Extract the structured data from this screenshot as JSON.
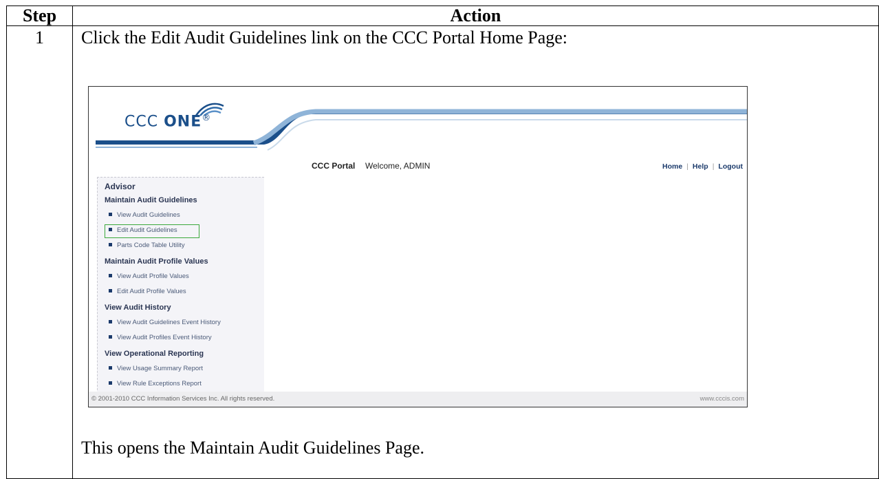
{
  "table": {
    "header_step": "Step",
    "header_action": "Action",
    "rows": [
      {
        "step": "1",
        "instruction": "Click the Edit Audit Guidelines link on the CCC Portal Home Page:",
        "result": "This opens the Maintain Audit Guidelines Page."
      }
    ]
  },
  "screenshot": {
    "logo": {
      "word1": "CCC ",
      "word2": "ONE",
      "mark": "®"
    },
    "portal_name": "CCC Portal",
    "welcome": "Welcome,  ADMIN",
    "top_links": [
      "Home",
      "Help",
      "Logout"
    ],
    "sidebar": {
      "title": "Advisor",
      "sections": [
        {
          "heading": "Maintain Audit Guidelines",
          "items": [
            "View Audit Guidelines",
            "Edit Audit Guidelines",
            "Parts Code Table Utility"
          ]
        },
        {
          "heading": "Maintain Audit Profile Values",
          "items": [
            "View Audit Profile Values",
            "Edit Audit Profile Values"
          ]
        },
        {
          "heading": "View Audit History",
          "items": [
            "View Audit Guidelines Event History",
            "View Audit Profiles Event History"
          ]
        },
        {
          "heading": "View Operational Reporting",
          "items": [
            "View Usage Summary Report",
            "View Rule Exceptions Report"
          ]
        }
      ]
    },
    "highlighted_item": "Edit Audit Guidelines",
    "highlight_color": "#3aa83a",
    "footer_copyright": "© 2001-2010 CCC Information Services Inc. All rights reserved.",
    "footer_site": "www.cccis.com"
  }
}
